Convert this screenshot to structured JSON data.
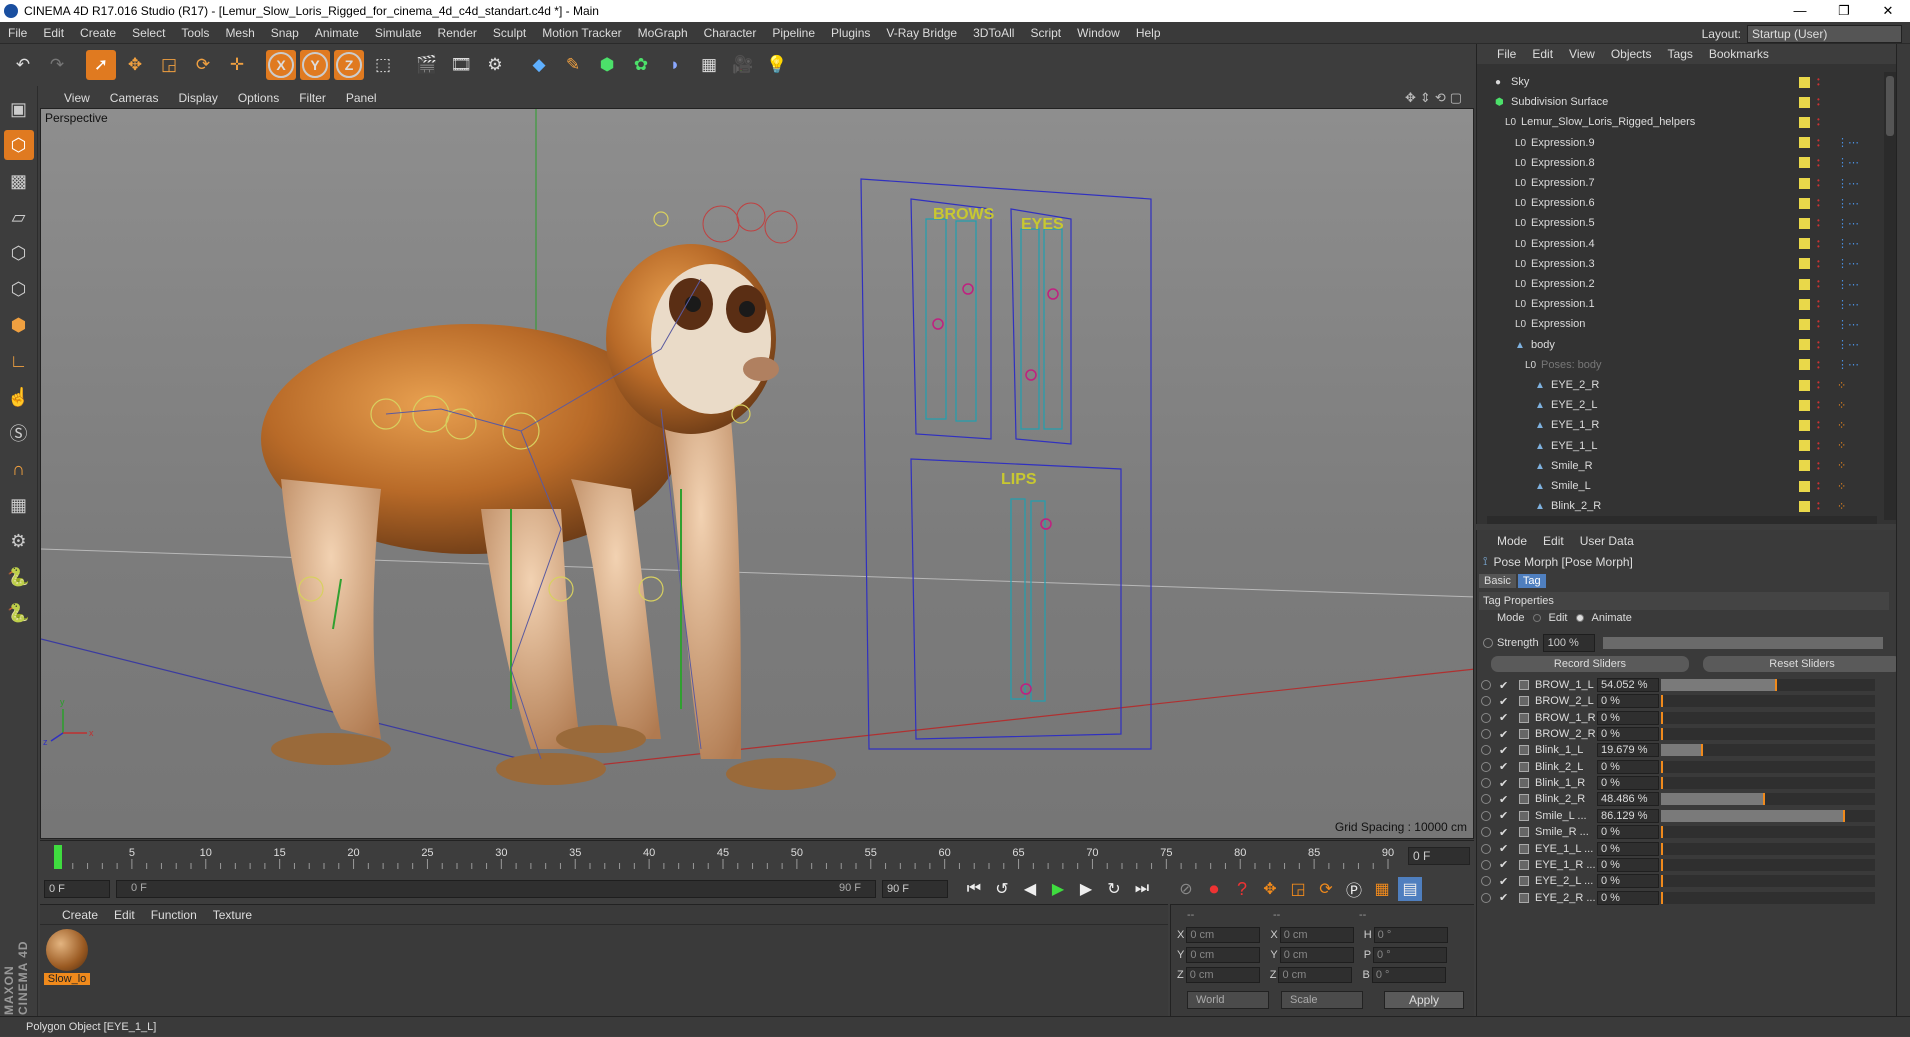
{
  "window": {
    "title": "CINEMA 4D R17.016 Studio (R17) - [Lemur_Slow_Loris_Rigged_for_cinema_4d_c4d_standart.c4d *] - Main",
    "controls": [
      "—",
      "❐",
      "✕"
    ]
  },
  "menubar": [
    "File",
    "Edit",
    "Create",
    "Select",
    "Tools",
    "Mesh",
    "Snap",
    "Animate",
    "Simulate",
    "Render",
    "Sculpt",
    "Motion Tracker",
    "MoGraph",
    "Character",
    "Pipeline",
    "Plugins",
    "V-Ray Bridge",
    "3DToAll",
    "Script",
    "Window",
    "Help"
  ],
  "layout": {
    "label": "Layout:",
    "value": "Startup (User)"
  },
  "toolbar": {
    "axis_x": "X",
    "axis_y": "Y",
    "axis_z": "Z"
  },
  "viewport": {
    "menu": [
      "View",
      "Cameras",
      "Display",
      "Options",
      "Filter",
      "Panel"
    ],
    "label": "Perspective",
    "grid_spacing": "Grid Spacing : 10000 cm",
    "panel_labels": {
      "brows": "BROWS",
      "eyes": "EYES",
      "lips": "LIPS"
    }
  },
  "timeline": {
    "ticks": [
      "0",
      "5",
      "10",
      "15",
      "20",
      "25",
      "30",
      "35",
      "40",
      "45",
      "50",
      "55",
      "60",
      "65",
      "70",
      "75",
      "80",
      "85",
      "90"
    ],
    "end_field": "0 F"
  },
  "transport": {
    "current": "0 F",
    "range_start": "0 F",
    "range_end": "90 F",
    "max": "90 F"
  },
  "materials": {
    "menu": [
      "Create",
      "Edit",
      "Function",
      "Texture"
    ],
    "items": [
      {
        "name": "Slow_lo"
      }
    ]
  },
  "coords": {
    "header": [
      "--",
      "--",
      "--"
    ],
    "rows": [
      {
        "a": "X",
        "av": "0 cm",
        "b": "X",
        "bv": "0 cm",
        "c": "H",
        "cv": "0 °"
      },
      {
        "a": "Y",
        "av": "0 cm",
        "b": "Y",
        "bv": "0 cm",
        "c": "P",
        "cv": "0 °"
      },
      {
        "a": "Z",
        "av": "0 cm",
        "b": "Z",
        "bv": "0 cm",
        "c": "B",
        "cv": "0 °"
      }
    ],
    "mode1": "World",
    "mode2": "Scale",
    "apply": "Apply"
  },
  "status": "Polygon Object [EYE_1_L]",
  "objects": {
    "menu": [
      "File",
      "Edit",
      "View",
      "Objects",
      "Tags",
      "Bookmarks"
    ],
    "rows": [
      {
        "name": "Sky",
        "icon": "sky-icon",
        "indent": 0
      },
      {
        "name": "Subdivision Surface",
        "icon": "subdivision-icon",
        "indent": 0
      },
      {
        "name": "Lemur_Slow_Loris_Rigged_helpers",
        "icon": "null-icon",
        "indent": 1
      },
      {
        "name": "Expression.9",
        "icon": "null-icon",
        "indent": 2
      },
      {
        "name": "Expression.8",
        "icon": "null-icon",
        "indent": 2
      },
      {
        "name": "Expression.7",
        "icon": "null-icon",
        "indent": 2
      },
      {
        "name": "Expression.6",
        "icon": "null-icon",
        "indent": 2
      },
      {
        "name": "Expression.5",
        "icon": "null-icon",
        "indent": 2
      },
      {
        "name": "Expression.4",
        "icon": "null-icon",
        "indent": 2
      },
      {
        "name": "Expression.3",
        "icon": "null-icon",
        "indent": 2
      },
      {
        "name": "Expression.2",
        "icon": "null-icon",
        "indent": 2
      },
      {
        "name": "Expression.1",
        "icon": "null-icon",
        "indent": 2
      },
      {
        "name": "Expression",
        "icon": "null-icon",
        "indent": 2
      },
      {
        "name": "body",
        "icon": "polygon-icon",
        "indent": 2
      },
      {
        "name": "Poses: body",
        "icon": "null-icon",
        "indent": 3
      },
      {
        "name": "EYE_2_R",
        "icon": "polygon-icon",
        "indent": 4
      },
      {
        "name": "EYE_2_L",
        "icon": "polygon-icon",
        "indent": 4
      },
      {
        "name": "EYE_1_R",
        "icon": "polygon-icon",
        "indent": 4
      },
      {
        "name": "EYE_1_L",
        "icon": "polygon-icon",
        "indent": 4
      },
      {
        "name": "Smile_R",
        "icon": "polygon-icon",
        "indent": 4
      },
      {
        "name": "Smile_L",
        "icon": "polygon-icon",
        "indent": 4
      },
      {
        "name": "Blink_2_R",
        "icon": "polygon-icon",
        "indent": 4
      }
    ]
  },
  "attributes": {
    "menu": [
      "Mode",
      "Edit",
      "User Data"
    ],
    "title": "Pose Morph [Pose Morph]",
    "tabs": [
      "Basic",
      "Tag"
    ],
    "section": "Tag Properties",
    "mode_label": "Mode",
    "mode_edit": "Edit",
    "mode_animate": "Animate",
    "strength_label": "Strength",
    "strength_value": "100 %",
    "record": "Record Sliders",
    "reset": "Reset Sliders",
    "sliders": [
      {
        "name": "BROW_1_L",
        "value": "54.052 %",
        "fill": 0.54
      },
      {
        "name": "BROW_2_L",
        "value": "0 %",
        "fill": 0
      },
      {
        "name": "BROW_1_R",
        "value": "0 %",
        "fill": 0
      },
      {
        "name": "BROW_2_R",
        "value": "0 %",
        "fill": 0
      },
      {
        "name": "Blink_1_L",
        "value": "19.679 %",
        "fill": 0.197
      },
      {
        "name": "Blink_2_L",
        "value": "0 %",
        "fill": 0
      },
      {
        "name": "Blink_1_R",
        "value": "0 %",
        "fill": 0
      },
      {
        "name": "Blink_2_R",
        "value": "48.486 %",
        "fill": 0.485
      },
      {
        "name": "Smile_L ...",
        "value": "86.129 %",
        "fill": 0.861
      },
      {
        "name": "Smile_R ...",
        "value": "0 %",
        "fill": 0
      },
      {
        "name": "EYE_1_L ...",
        "value": "0 %",
        "fill": 0
      },
      {
        "name": "EYE_1_R ...",
        "value": "0 %",
        "fill": 0
      },
      {
        "name": "EYE_2_L ...",
        "value": "0 %",
        "fill": 0
      },
      {
        "name": "EYE_2_R ...",
        "value": "0 %",
        "fill": 0
      }
    ]
  }
}
